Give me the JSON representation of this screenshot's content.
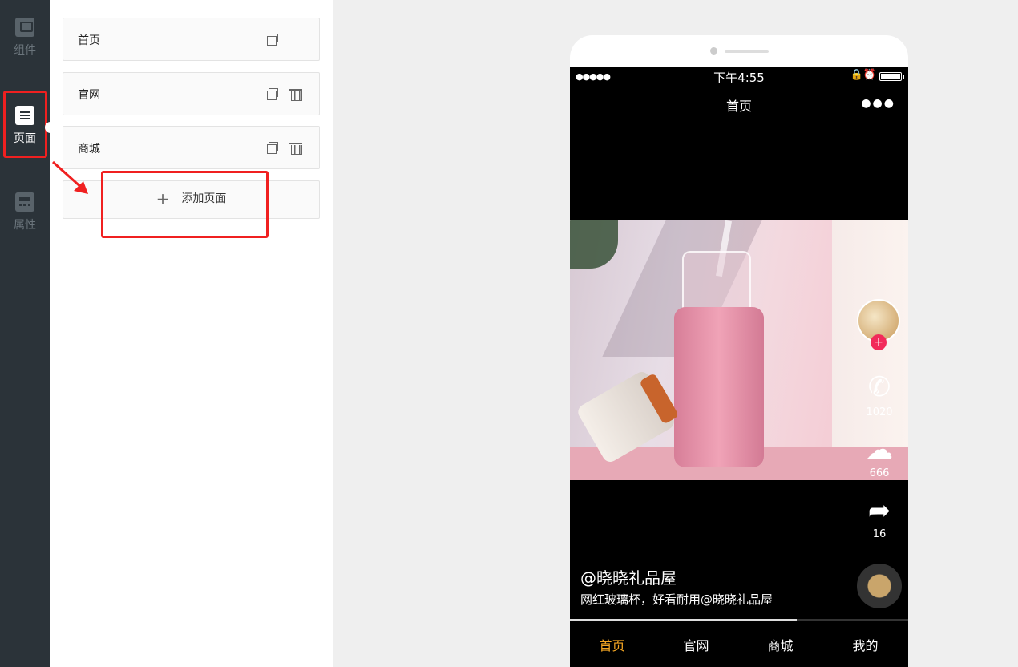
{
  "rail": {
    "items": [
      {
        "label": "组件",
        "icon": "component-icon"
      },
      {
        "label": "页面",
        "icon": "page-icon"
      },
      {
        "label": "属性",
        "icon": "property-icon"
      }
    ]
  },
  "pages": {
    "items": [
      {
        "label": "首页"
      },
      {
        "label": "官网"
      },
      {
        "label": "商城"
      }
    ],
    "add_label": "添加页面",
    "add_icon": "+"
  },
  "phone": {
    "status": {
      "signal": "●●●●●",
      "time": "下午4:55",
      "icons": "🔒⏰"
    },
    "nav_title": "首页",
    "more": "●●●",
    "actions": {
      "follow": "+",
      "phone_count": "1020",
      "wechat_count": "666",
      "share_count": "16"
    },
    "author": "@晓晓礼品屋",
    "description": "网红玻璃杯，好看耐用@晓晓礼品屋",
    "progress_percent": 67,
    "tabs": [
      {
        "label": "首页"
      },
      {
        "label": "官网"
      },
      {
        "label": "商城"
      },
      {
        "label": "我的"
      }
    ]
  },
  "colors": {
    "accent_tab": "#f5a623",
    "highlight": "#f02020",
    "follow": "#f22a5a"
  }
}
